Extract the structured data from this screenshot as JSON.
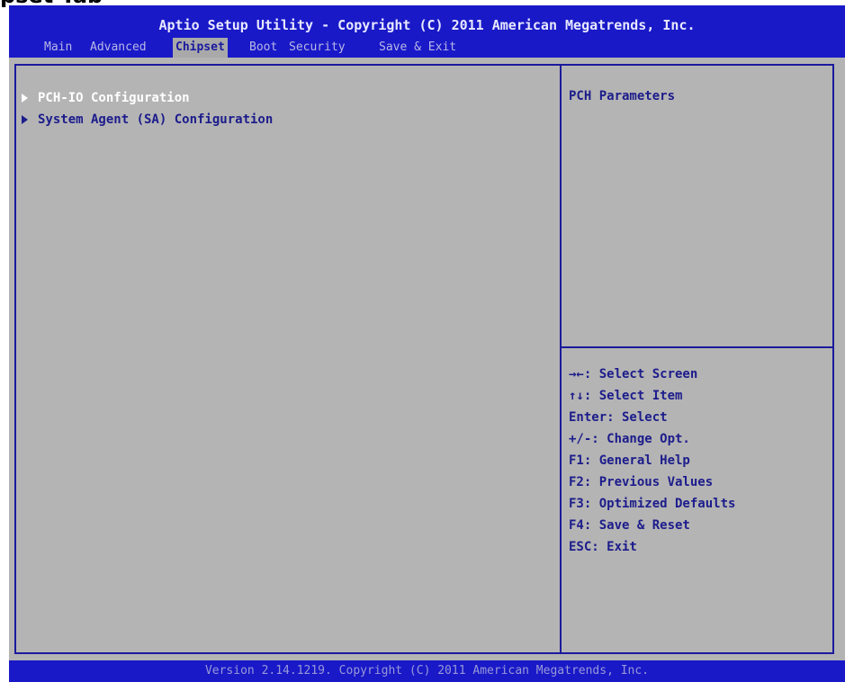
{
  "external_caption": "pset Tab",
  "header": {
    "title": "Aptio Setup Utility - Copyright (C) 2011 American Megatrends, Inc.",
    "tabs": [
      {
        "label": "Main",
        "active": false
      },
      {
        "label": "Advanced",
        "active": false
      },
      {
        "label": "Chipset",
        "active": true
      },
      {
        "label": "Boot",
        "active": false
      },
      {
        "label": "Security",
        "active": false
      },
      {
        "label": "Save & Exit",
        "active": false
      }
    ]
  },
  "menu": {
    "items": [
      {
        "label": "PCH-IO Configuration",
        "selected": true
      },
      {
        "label": "System Agent (SA) Configuration",
        "selected": false
      }
    ]
  },
  "help": {
    "description": "PCH Parameters",
    "keys": [
      "→←: Select Screen",
      "↑↓: Select Item",
      "Enter: Select",
      "+/-: Change Opt.",
      "F1: General Help",
      "F2: Previous Values",
      "F3: Optimized Defaults",
      "F4: Save & Reset",
      "ESC: Exit"
    ]
  },
  "footer": {
    "version": "Version 2.14.1219. Copyright (C) 2011 American Megatrends, Inc."
  },
  "colors": {
    "header_bg": "#1919c8",
    "panel_bg": "#b4b4b4",
    "text": "#1c1c8c",
    "selected_text": "#ffffff"
  }
}
